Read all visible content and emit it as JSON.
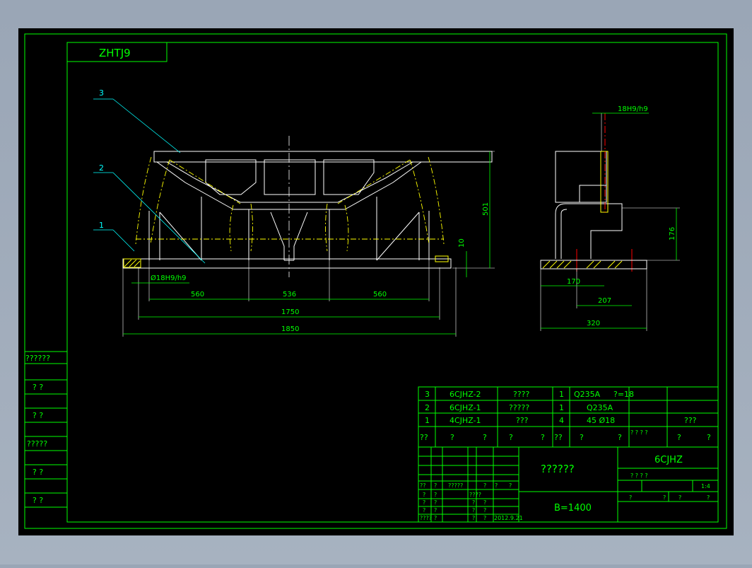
{
  "colors": {
    "background": "#000000",
    "frame": "#00ff00",
    "geometry": "#ffffff",
    "leader": "#00ffff",
    "centerline": "#ff0000",
    "phantom": "#ffff00",
    "hatch": "#ffff00"
  },
  "drawing_code": "ZHTJ9",
  "balloons": [
    "3",
    "2",
    "1"
  ],
  "front_view": {
    "dims": {
      "d560a": "560",
      "d536": "536",
      "d560b": "560",
      "d1750": "1750",
      "d1850": "1850",
      "d501": "501",
      "d10": "10",
      "fit": "Ø18H9/h9"
    }
  },
  "side_view": {
    "dims": {
      "fit": "18H9/h9",
      "d176": "176",
      "d170": "170",
      "d207": "207",
      "d320": "320"
    }
  },
  "left_column": [
    "??????",
    "?   ?",
    "?   ?",
    "?????",
    "?   ?",
    "?   ?"
  ],
  "bom": [
    {
      "no": "3",
      "code": "6CJHZ-2",
      "name": "????",
      "qty": "1",
      "mat": "Q235A",
      "note": "?=18"
    },
    {
      "no": "2",
      "code": "6CJHZ-1",
      "name": "?????",
      "qty": "1",
      "mat": "Q235A",
      "note": ""
    },
    {
      "no": "1",
      "code": "4CJHZ-1",
      "name": "???",
      "qty": "4",
      "mat": "45 Ø18",
      "note": "???"
    }
  ],
  "bom_header": [
    "??",
    "?",
    "?",
    "?",
    "?",
    "??",
    "?",
    "?",
    "? ? ? ?",
    "?",
    "?"
  ],
  "title_block": {
    "drawing_name": "??????",
    "spec": "B=1400",
    "drawing_no": "6CJHZ",
    "scale_row": "? ? ? ?",
    "scale": "1:4",
    "sheet_row": [
      "?",
      "?",
      "?",
      "?"
    ],
    "sign_rows": [
      [
        "??",
        "?",
        "?????",
        "?",
        "?",
        "?"
      ],
      [
        "?",
        "?",
        "????",
        ""
      ],
      [
        "?",
        "?",
        "?",
        "?"
      ],
      [
        "?",
        "?",
        "?",
        "?"
      ],
      [
        "????",
        "?",
        "?",
        "?",
        "2012.9.21"
      ]
    ]
  }
}
